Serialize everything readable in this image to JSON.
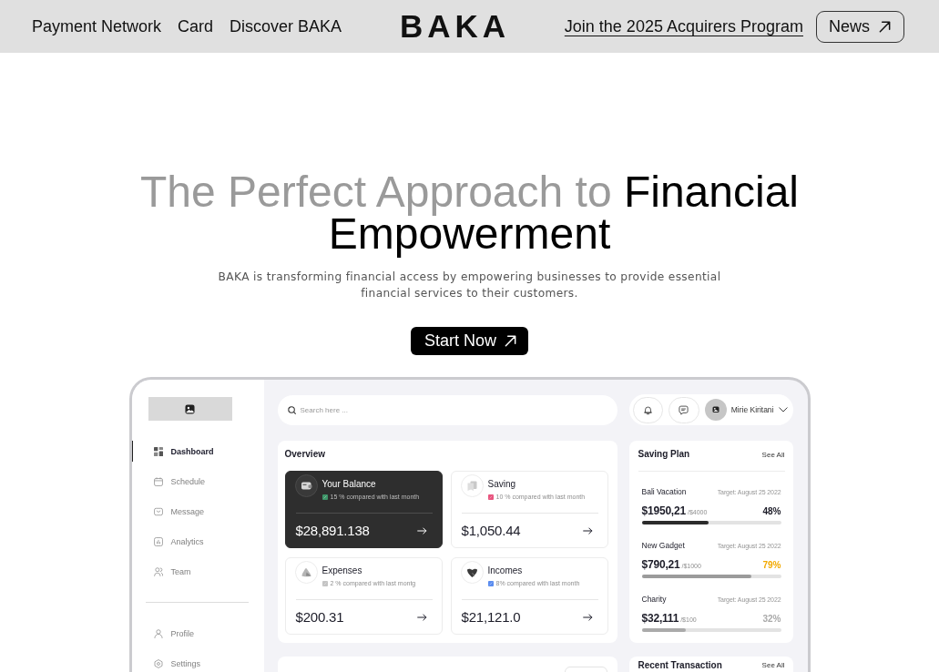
{
  "nav": {
    "links": [
      {
        "label": "Payment Network"
      },
      {
        "label": "Card"
      },
      {
        "label": "Discover BAKA"
      }
    ],
    "logo": "BAKA",
    "program_link": "Join the 2025 Acquirers Program",
    "news_button": "News"
  },
  "hero": {
    "title": [
      {
        "text": "The Perfect Approach to",
        "emphasis": false
      },
      {
        "text": "Financial Empowerment",
        "emphasis": true
      }
    ],
    "subtitle": "BAKA is transforming financial access by empowering businesses to provide essential financial services to their customers.",
    "button": "Start Now"
  },
  "dashboard": {
    "sidebar": {
      "items": [
        {
          "label": "Dashboard",
          "selected": true
        },
        {
          "label": "Schedule",
          "selected": false
        },
        {
          "label": "Message",
          "selected": false
        },
        {
          "label": "Analytics",
          "selected": false
        },
        {
          "label": "Team",
          "selected": false
        }
      ],
      "bottom_items": [
        {
          "label": "Profile",
          "selected": false
        },
        {
          "label": "Settings",
          "selected": false
        }
      ]
    },
    "search": {
      "placeholder": "Search here ..."
    },
    "user": {
      "name": "Mirie Kiritani"
    },
    "overview": {
      "title": "Overview",
      "cards": [
        {
          "title": "Your Balance",
          "change": "15 % compared with last month",
          "color": "#3d9468",
          "amount": "$28,891.138",
          "selected": true
        },
        {
          "title": "Saving",
          "change": "10 % compared with last month",
          "color": "#e8557f",
          "amount": "$1,050.44",
          "selected": false
        },
        {
          "title": "Expenses",
          "change": "2 % compared with last montg",
          "color": "#c4c4c4",
          "amount": "$200.31",
          "selected": false
        },
        {
          "title": "Incomes",
          "change": "8% compared with last month",
          "color": "#5b8def",
          "amount": "$21,121.0",
          "selected": false
        }
      ]
    },
    "saving_plan": {
      "title": "Saving Plan",
      "link": "See All",
      "items": [
        {
          "name": "Bali Vacation",
          "target": "Target: August 25 2022",
          "amount": "$1950,21",
          "goal": "/$4000",
          "percent": {
            "text": "48%",
            "color": "#1c1c28"
          },
          "level": 0.48,
          "color": "#2b2b2b"
        },
        {
          "name": "New Gadget",
          "target": "Target: August 25 2022",
          "amount": "$790,21",
          "goal": "/$1000",
          "percent": {
            "text": "79%",
            "color": "#f2a900"
          },
          "level": 0.79,
          "color": "#9b9b9b"
        },
        {
          "name": "Charity",
          "target": "Target: August 25 2022",
          "amount": "$32,111",
          "goal": "/$100",
          "percent": {
            "text": "32%",
            "color": "#aaaaaa"
          },
          "level": 0.32,
          "color": "#aaaaaa"
        }
      ]
    },
    "recent_transaction": {
      "title": "Recent Transaction",
      "link": "See All"
    }
  }
}
